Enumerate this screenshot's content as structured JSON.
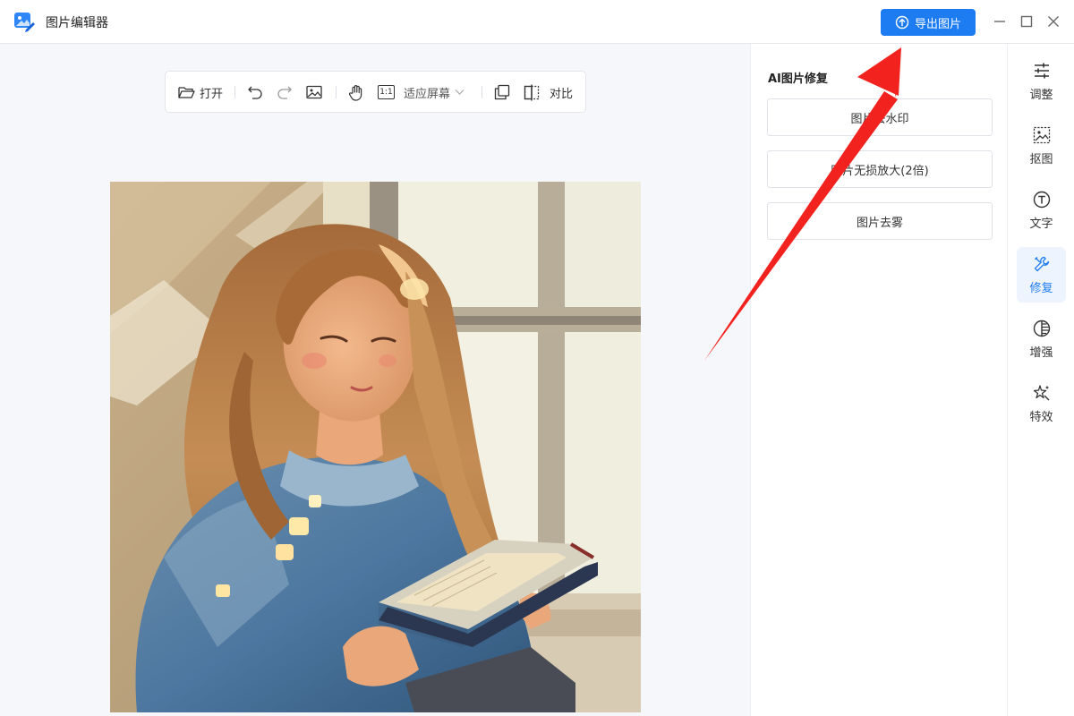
{
  "app": {
    "title": "图片编辑器"
  },
  "header": {
    "export_label": "导出图片"
  },
  "toolbar": {
    "open_label": "打开",
    "ratio_label": "1:1",
    "fit_label": "适应屏幕",
    "compare_label": "对比"
  },
  "panel": {
    "title": "AI图片修复",
    "buttons": [
      {
        "label": "图片去水印"
      },
      {
        "label": "图片无损放大(2倍)"
      },
      {
        "label": "图片去雾"
      }
    ]
  },
  "sidebar": {
    "items": [
      {
        "label": "调整",
        "icon": "sliders-icon"
      },
      {
        "label": "抠图",
        "icon": "image-cutout-icon"
      },
      {
        "label": "文字",
        "icon": "text-icon"
      },
      {
        "label": "修复",
        "icon": "wrench-icon",
        "active": true
      },
      {
        "label": "增强",
        "icon": "enhance-icon"
      },
      {
        "label": "特效",
        "icon": "sparkle-icon"
      }
    ]
  },
  "colors": {
    "accent": "#1e7cf2",
    "annotation_arrow": "#f2231e"
  }
}
